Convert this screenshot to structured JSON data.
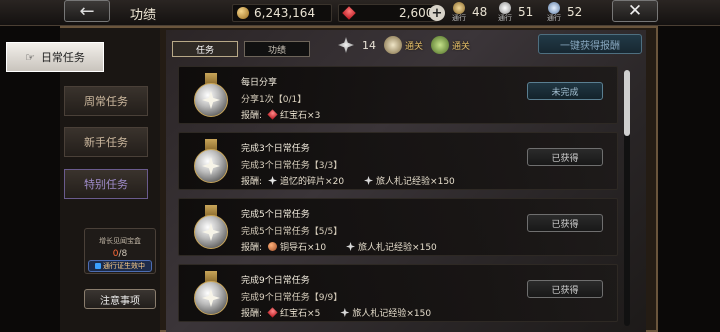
{
  "header": {
    "title": "功绩",
    "gold": "6,243,164",
    "rubies": "2,600",
    "mini_resources": [
      {
        "caption": "通行",
        "value": "48",
        "color": "#caa765"
      },
      {
        "caption": "通行",
        "value": "51",
        "color": "#d9d9d9"
      },
      {
        "caption": "通行",
        "value": "52",
        "color": "#a9c7f0"
      }
    ]
  },
  "sidebar": {
    "items": [
      {
        "label": "日常任务",
        "state": "active"
      },
      {
        "label": "周常任务",
        "state": "normal"
      },
      {
        "label": "新手任务",
        "state": "normal"
      },
      {
        "label": "特别任务",
        "state": "purple"
      }
    ],
    "box_label": "增长见闻宝盒",
    "box_count_current": "0",
    "box_count_total": "/8",
    "pass_badge": "通行证生效中",
    "notice_label": "注意事项"
  },
  "tabs": [
    {
      "label": "任务"
    },
    {
      "label": "功绩"
    }
  ],
  "summary": {
    "medal_count": "14",
    "tier1_text": "通关",
    "tier2_text": "通关",
    "claim_all_label": "一键获得报酬"
  },
  "tasks": [
    {
      "name": "每日分享",
      "progress": "分享1次【0/1】",
      "reward_label": "报酬:",
      "rewards": [
        {
          "icon": "ruby-icon",
          "text": "红宝石×3"
        }
      ],
      "status": "未完成",
      "status_type": "pending"
    },
    {
      "name": "完成3个日常任务",
      "progress": "完成3个日常任务【3/3】",
      "reward_label": "报酬:",
      "rewards": [
        {
          "icon": "shard-icon",
          "text": "追忆的碎片×20"
        },
        {
          "icon": "exp-icon",
          "text": "旅人札记经验×150"
        }
      ],
      "status": "已获得",
      "status_type": "done"
    },
    {
      "name": "完成5个日常任务",
      "progress": "完成5个日常任务【5/5】",
      "reward_label": "报酬:",
      "rewards": [
        {
          "icon": "copper-icon",
          "text": "铜导石×10"
        },
        {
          "icon": "exp-icon",
          "text": "旅人札记经验×150"
        }
      ],
      "status": "已获得",
      "status_type": "done"
    },
    {
      "name": "完成9个日常任务",
      "progress": "完成9个日常任务【9/9】",
      "reward_label": "报酬:",
      "rewards": [
        {
          "icon": "ruby-icon",
          "text": "红宝石×5"
        },
        {
          "icon": "exp-icon",
          "text": "旅人札记经验×150"
        }
      ],
      "status": "已获得",
      "status_type": "done"
    }
  ]
}
